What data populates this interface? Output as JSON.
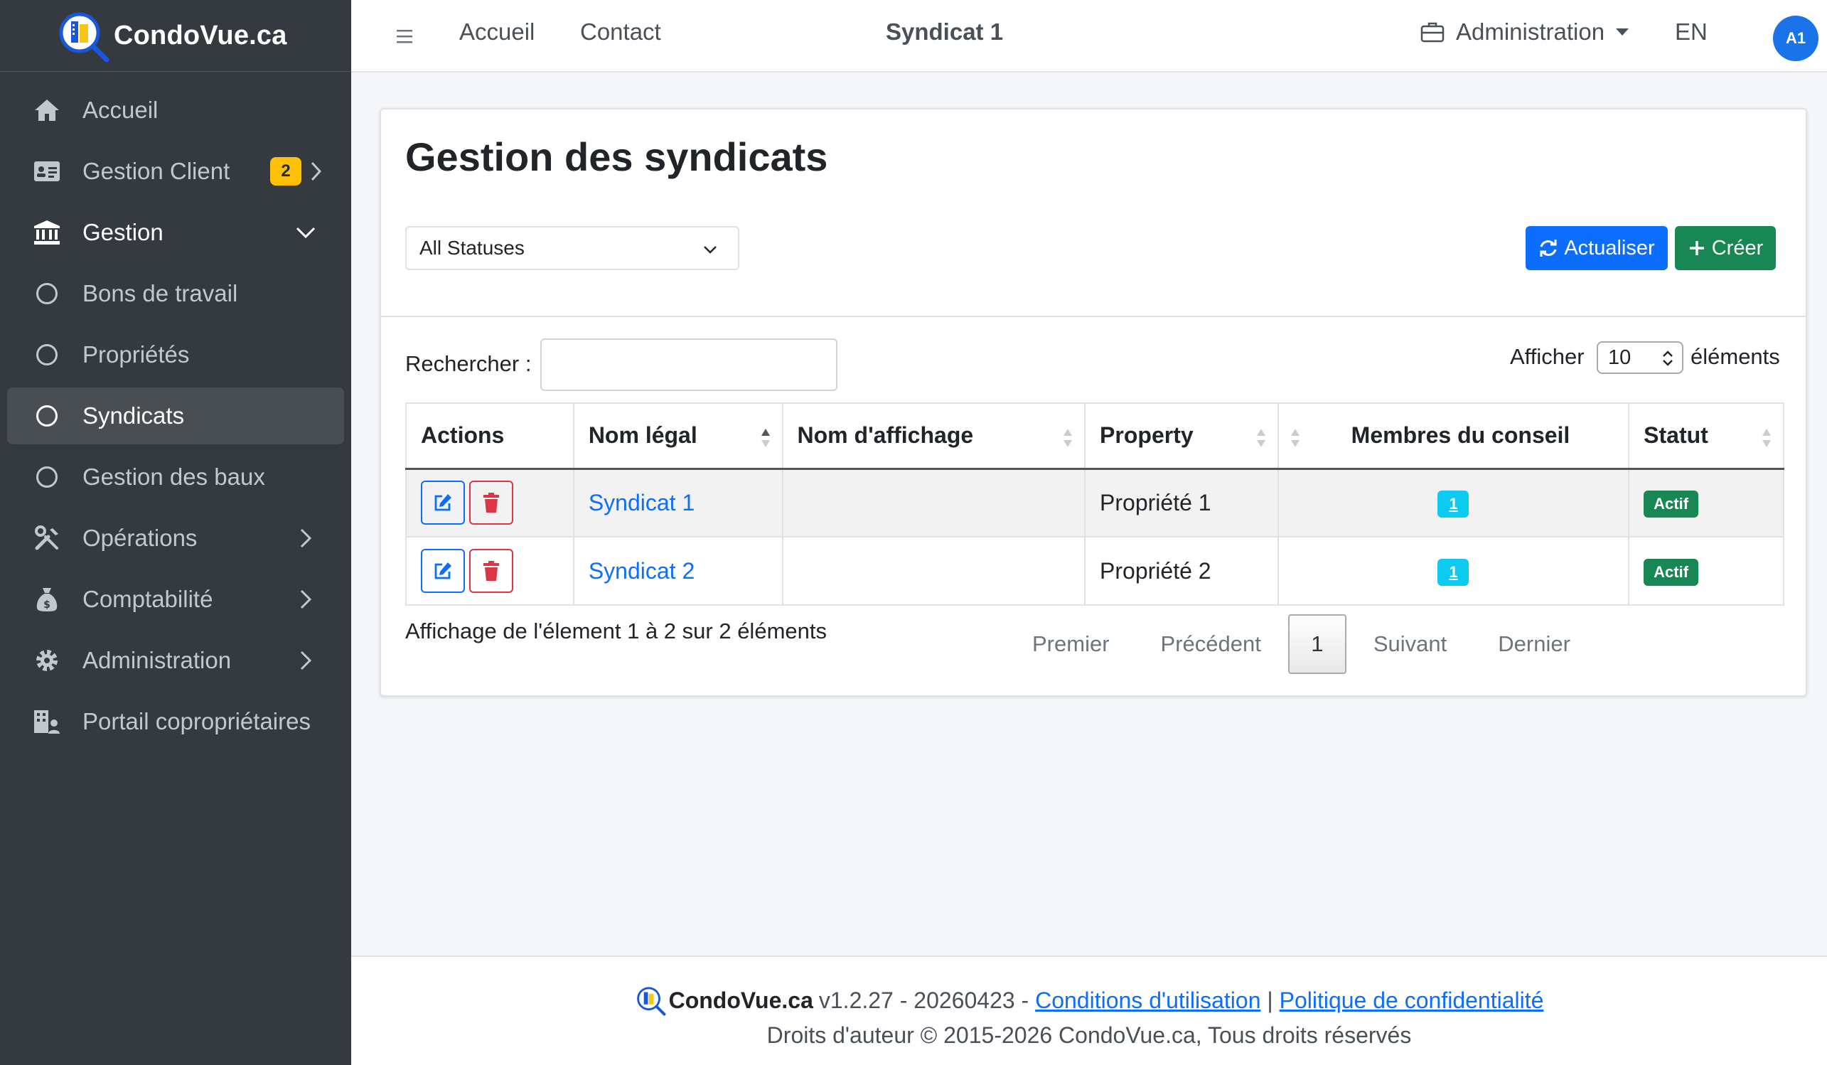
{
  "brand": {
    "name": "CondoVue.ca"
  },
  "sidebar": {
    "items": [
      {
        "label": "Accueil",
        "icon": "home-icon"
      },
      {
        "label": "Gestion Client",
        "icon": "id-card-icon",
        "badge": "2"
      },
      {
        "label": "Gestion",
        "icon": "bank-icon"
      },
      {
        "label": "Bons de travail",
        "icon": "circle-icon"
      },
      {
        "label": "Propriétés",
        "icon": "circle-icon"
      },
      {
        "label": "Syndicats",
        "icon": "circle-icon"
      },
      {
        "label": "Gestion des baux",
        "icon": "circle-icon"
      },
      {
        "label": "Opérations",
        "icon": "tools-icon"
      },
      {
        "label": "Comptabilité",
        "icon": "money-bag-icon"
      },
      {
        "label": "Administration",
        "icon": "gear-icon"
      },
      {
        "label": "Portail copropriétaires",
        "icon": "building-users-icon"
      }
    ]
  },
  "header": {
    "nav": [
      "Accueil",
      "Contact"
    ],
    "title": "Syndicat 1",
    "admin": "Administration",
    "lang": "EN",
    "avatar": "A1"
  },
  "card": {
    "title": "Gestion des syndicats",
    "status_filter": "All Statuses",
    "refresh_label": "Actualiser",
    "create_label": "Créer",
    "search_label": "Rechercher :",
    "show_label": "Afficher",
    "show_value": "10",
    "show_suffix": "éléments"
  },
  "table": {
    "columns": [
      "Actions",
      "Nom légal",
      "Nom d'affichage",
      "Property",
      "Membres du conseil",
      "Statut"
    ],
    "rows": [
      {
        "nom_legal": "Syndicat 1",
        "nom_affichage": "",
        "property": "Propriété 1",
        "membres": "1",
        "statut": "Actif"
      },
      {
        "nom_legal": "Syndicat 2",
        "nom_affichage": "",
        "property": "Propriété 2",
        "membres": "1",
        "statut": "Actif"
      }
    ]
  },
  "pagination": {
    "info": "Affichage de l'élement 1 à 2 sur 2 éléments",
    "first": "Premier",
    "prev": "Précédent",
    "current": "1",
    "next": "Suivant",
    "last": "Dernier"
  },
  "footer": {
    "brand": "CondoVue.ca",
    "version": "v1.2.27 - 20260423 -",
    "terms": "Conditions d'utilisation",
    "sep": "|",
    "privacy": "Politique de confidentialité",
    "copyright": "Droits d'auteur © 2015-2026 CondoVue.ca, Tous droits réservés"
  },
  "colors": {
    "sidebar_bg": "#343a40",
    "primary": "#0d6efd",
    "success": "#198754",
    "danger": "#dc3545",
    "warning": "#ffc107",
    "info": "#0dcaf0"
  }
}
